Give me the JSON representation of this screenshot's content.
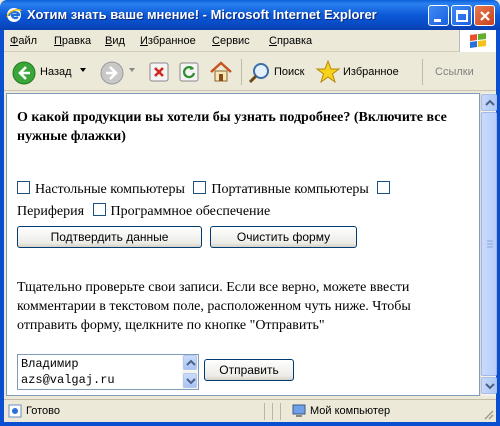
{
  "window": {
    "title": "Хотим знать ваше мнение! - Microsoft Internet Explorer"
  },
  "menu": {
    "items": [
      "Файл",
      "Правка",
      "Вид",
      "Избранное",
      "Сервис",
      "Справка"
    ]
  },
  "toolbar": {
    "back_label": "Назад",
    "search_label": "Поиск",
    "favorites_label": "Избранное",
    "links_label": "Ссылки"
  },
  "form": {
    "question": "О какой продукции вы хотели бы узнать подробнее? (Включите все нужные флажки)",
    "options": [
      "Настольные компьютеры",
      "Портативные компьютеры",
      "Периферия",
      "Программное обеспечение"
    ],
    "submit_data_label": "Подтвердить данные",
    "clear_form_label": "Очистить форму",
    "note": "Тщательно проверьте свои записи. Если все верно, можете ввести комментарии в текстовом поле, расположенном чуть ниже. Чтобы отправить форму, щелкните по кнопке \"Отправить\"",
    "comment_lines": [
      "Владимир",
      "azs@valgaj.ru"
    ],
    "send_label": "Отправить"
  },
  "status": {
    "left_text": "Готово",
    "zone_text": "Мой компьютер"
  },
  "colors": {
    "title_bar": "#0b59d6",
    "window_frame": "#0a4fd0",
    "chrome_bg": "#ece9d8",
    "button_border": "#003c74"
  }
}
